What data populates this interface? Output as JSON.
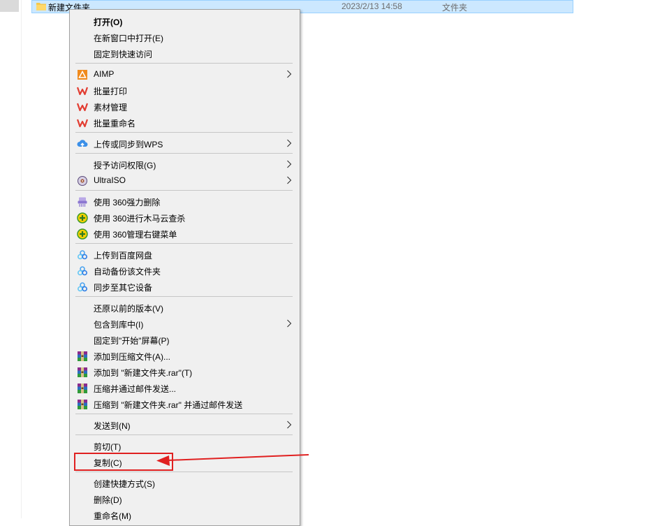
{
  "file_row": {
    "name": "新建文件夹",
    "date": "2023/2/13 14:58",
    "type": "文件夹"
  },
  "menu": {
    "items": [
      {
        "label": "打开(O)",
        "icon": "",
        "bold": true
      },
      {
        "label": "在新窗口中打开(E)",
        "icon": ""
      },
      {
        "label": "固定到快速访问",
        "icon": ""
      },
      {
        "label": "AIMP",
        "icon": "aimp-icon",
        "submenu": true
      },
      {
        "label": "批量打印",
        "icon": "wps-icon"
      },
      {
        "label": "素材管理",
        "icon": "wps-icon"
      },
      {
        "label": "批量重命名",
        "icon": "wps-icon"
      },
      {
        "label": "上传或同步到WPS",
        "icon": "cloud-upload-icon",
        "submenu": true
      },
      {
        "label": "授予访问权限(G)",
        "icon": "",
        "submenu": true
      },
      {
        "label": "UltraISO",
        "icon": "ultraiso-icon",
        "submenu": true
      },
      {
        "label": "使用 360强力删除",
        "icon": "shredder-icon"
      },
      {
        "label": "使用 360进行木马云查杀",
        "icon": "360-icon"
      },
      {
        "label": "使用 360管理右键菜单",
        "icon": "360-icon"
      },
      {
        "label": "上传到百度网盘",
        "icon": "baidu-cloud-icon"
      },
      {
        "label": "自动备份该文件夹",
        "icon": "baidu-cloud-icon"
      },
      {
        "label": "同步至其它设备",
        "icon": "baidu-cloud-icon"
      },
      {
        "label": "还原以前的版本(V)",
        "icon": ""
      },
      {
        "label": "包含到库中(I)",
        "icon": "",
        "submenu": true
      },
      {
        "label": "固定到\"开始\"屏幕(P)",
        "icon": ""
      },
      {
        "label": "添加到压缩文件(A)...",
        "icon": "winrar-icon"
      },
      {
        "label": "添加到 \"新建文件夹.rar\"(T)",
        "icon": "winrar-icon"
      },
      {
        "label": "压缩并通过邮件发送...",
        "icon": "winrar-icon"
      },
      {
        "label": "压缩到 \"新建文件夹.rar\" 并通过邮件发送",
        "icon": "winrar-icon"
      },
      {
        "label": "发送到(N)",
        "icon": "",
        "submenu": true
      },
      {
        "label": "剪切(T)",
        "icon": ""
      },
      {
        "label": "复制(C)",
        "icon": ""
      },
      {
        "label": "创建快捷方式(S)",
        "icon": ""
      },
      {
        "label": "删除(D)",
        "icon": ""
      },
      {
        "label": "重命名(M)",
        "icon": ""
      }
    ]
  },
  "colors": {
    "selection": "#cce8ff",
    "annotation": "#e02020",
    "menu_bg": "#f0f0f0"
  }
}
